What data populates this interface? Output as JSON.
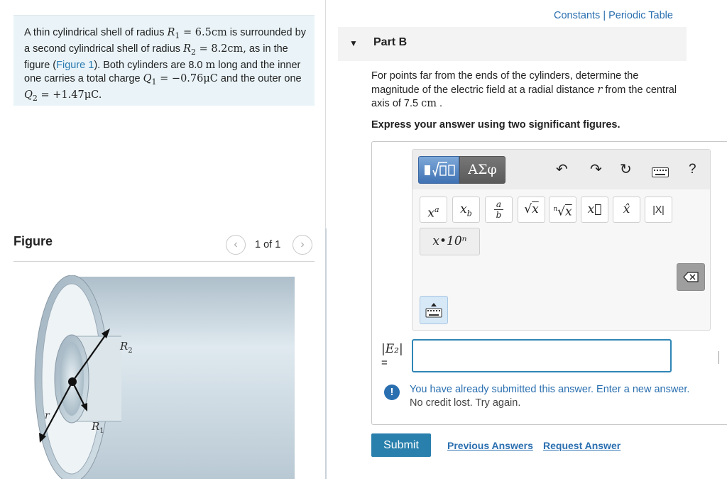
{
  "problem": {
    "text_1": "A thin cylindrical shell of radius",
    "r1_symbol": "R",
    "r1_sub": "1",
    "r1_value": " = 6.5cm",
    "text_2": " is surrounded by a second cylindrical shell of radius",
    "r2_symbol": "R",
    "r2_sub": "2",
    "r2_value": " = 8.2cm,",
    "text_3": " as in the figure (",
    "figure_link": "Figure 1",
    "text_4": "). Both cylinders are 8.0 ",
    "length_unit": "m",
    "text_5": " long and the inner one carries a total charge ",
    "q1_symbol": "Q",
    "q1_sub": "1",
    "q1_value": " = −0.76μC",
    "text_6": " and the outer one ",
    "q2_symbol": "Q",
    "q2_sub": "2",
    "q2_value": " = +1.47μC."
  },
  "figure": {
    "title": "Figure",
    "pager": "1 of 1",
    "labels": {
      "r2": "R",
      "r2_sub": "2",
      "r1": "R",
      "r1_sub": "1",
      "r": "r"
    }
  },
  "header_links": "Constants | Periodic Table",
  "part": {
    "title": "Part B",
    "question_1": "For points far from the ends of the cylinders, determine the magnitude of the electric field at a radial distance ",
    "question_var": "r",
    "question_2": " from the central axis of 7.5 ",
    "question_unit": "cm",
    "question_3": " .",
    "instruction": "Express your answer using two significant figures."
  },
  "editor": {
    "greek_label": "ΑΣφ",
    "templates": [
      "xa",
      "xb",
      "a/b",
      "√x",
      "ⁿ√x",
      "x⃗",
      "x̂",
      "|X|"
    ],
    "sci_label": "x•10ⁿ",
    "help": "?"
  },
  "answer": {
    "label": "|E₂|",
    "equals": "=",
    "value": ""
  },
  "feedback": {
    "line1": "You have already submitted this answer. Enter a new answer.",
    "line2": "No credit lost. Try again."
  },
  "buttons": {
    "submit": "Submit",
    "previous_answers": "Previous Answers",
    "request_answer": "Request Answer"
  },
  "colors": {
    "accent": "#2a6fb0",
    "submit": "#2980ad",
    "problem_bg": "#eaf4f8",
    "input_border": "#2f86b5"
  }
}
